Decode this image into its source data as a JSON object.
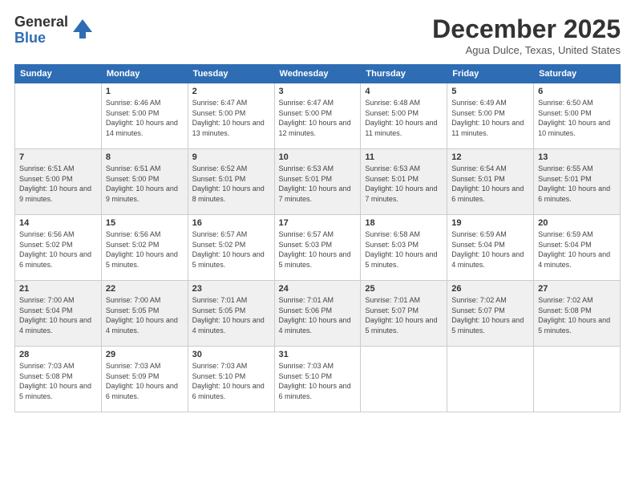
{
  "header": {
    "logo": {
      "general": "General",
      "blue": "Blue"
    },
    "title": "December 2025",
    "subtitle": "Agua Dulce, Texas, United States"
  },
  "weekdays": [
    "Sunday",
    "Monday",
    "Tuesday",
    "Wednesday",
    "Thursday",
    "Friday",
    "Saturday"
  ],
  "weeks": [
    [
      {
        "day": "",
        "sunrise": "",
        "sunset": "",
        "daylight": ""
      },
      {
        "day": "1",
        "sunrise": "Sunrise: 6:46 AM",
        "sunset": "Sunset: 5:00 PM",
        "daylight": "Daylight: 10 hours and 14 minutes."
      },
      {
        "day": "2",
        "sunrise": "Sunrise: 6:47 AM",
        "sunset": "Sunset: 5:00 PM",
        "daylight": "Daylight: 10 hours and 13 minutes."
      },
      {
        "day": "3",
        "sunrise": "Sunrise: 6:47 AM",
        "sunset": "Sunset: 5:00 PM",
        "daylight": "Daylight: 10 hours and 12 minutes."
      },
      {
        "day": "4",
        "sunrise": "Sunrise: 6:48 AM",
        "sunset": "Sunset: 5:00 PM",
        "daylight": "Daylight: 10 hours and 11 minutes."
      },
      {
        "day": "5",
        "sunrise": "Sunrise: 6:49 AM",
        "sunset": "Sunset: 5:00 PM",
        "daylight": "Daylight: 10 hours and 11 minutes."
      },
      {
        "day": "6",
        "sunrise": "Sunrise: 6:50 AM",
        "sunset": "Sunset: 5:00 PM",
        "daylight": "Daylight: 10 hours and 10 minutes."
      }
    ],
    [
      {
        "day": "7",
        "sunrise": "Sunrise: 6:51 AM",
        "sunset": "Sunset: 5:00 PM",
        "daylight": "Daylight: 10 hours and 9 minutes."
      },
      {
        "day": "8",
        "sunrise": "Sunrise: 6:51 AM",
        "sunset": "Sunset: 5:00 PM",
        "daylight": "Daylight: 10 hours and 9 minutes."
      },
      {
        "day": "9",
        "sunrise": "Sunrise: 6:52 AM",
        "sunset": "Sunset: 5:01 PM",
        "daylight": "Daylight: 10 hours and 8 minutes."
      },
      {
        "day": "10",
        "sunrise": "Sunrise: 6:53 AM",
        "sunset": "Sunset: 5:01 PM",
        "daylight": "Daylight: 10 hours and 7 minutes."
      },
      {
        "day": "11",
        "sunrise": "Sunrise: 6:53 AM",
        "sunset": "Sunset: 5:01 PM",
        "daylight": "Daylight: 10 hours and 7 minutes."
      },
      {
        "day": "12",
        "sunrise": "Sunrise: 6:54 AM",
        "sunset": "Sunset: 5:01 PM",
        "daylight": "Daylight: 10 hours and 6 minutes."
      },
      {
        "day": "13",
        "sunrise": "Sunrise: 6:55 AM",
        "sunset": "Sunset: 5:01 PM",
        "daylight": "Daylight: 10 hours and 6 minutes."
      }
    ],
    [
      {
        "day": "14",
        "sunrise": "Sunrise: 6:56 AM",
        "sunset": "Sunset: 5:02 PM",
        "daylight": "Daylight: 10 hours and 6 minutes."
      },
      {
        "day": "15",
        "sunrise": "Sunrise: 6:56 AM",
        "sunset": "Sunset: 5:02 PM",
        "daylight": "Daylight: 10 hours and 5 minutes."
      },
      {
        "day": "16",
        "sunrise": "Sunrise: 6:57 AM",
        "sunset": "Sunset: 5:02 PM",
        "daylight": "Daylight: 10 hours and 5 minutes."
      },
      {
        "day": "17",
        "sunrise": "Sunrise: 6:57 AM",
        "sunset": "Sunset: 5:03 PM",
        "daylight": "Daylight: 10 hours and 5 minutes."
      },
      {
        "day": "18",
        "sunrise": "Sunrise: 6:58 AM",
        "sunset": "Sunset: 5:03 PM",
        "daylight": "Daylight: 10 hours and 5 minutes."
      },
      {
        "day": "19",
        "sunrise": "Sunrise: 6:59 AM",
        "sunset": "Sunset: 5:04 PM",
        "daylight": "Daylight: 10 hours and 4 minutes."
      },
      {
        "day": "20",
        "sunrise": "Sunrise: 6:59 AM",
        "sunset": "Sunset: 5:04 PM",
        "daylight": "Daylight: 10 hours and 4 minutes."
      }
    ],
    [
      {
        "day": "21",
        "sunrise": "Sunrise: 7:00 AM",
        "sunset": "Sunset: 5:04 PM",
        "daylight": "Daylight: 10 hours and 4 minutes."
      },
      {
        "day": "22",
        "sunrise": "Sunrise: 7:00 AM",
        "sunset": "Sunset: 5:05 PM",
        "daylight": "Daylight: 10 hours and 4 minutes."
      },
      {
        "day": "23",
        "sunrise": "Sunrise: 7:01 AM",
        "sunset": "Sunset: 5:05 PM",
        "daylight": "Daylight: 10 hours and 4 minutes."
      },
      {
        "day": "24",
        "sunrise": "Sunrise: 7:01 AM",
        "sunset": "Sunset: 5:06 PM",
        "daylight": "Daylight: 10 hours and 4 minutes."
      },
      {
        "day": "25",
        "sunrise": "Sunrise: 7:01 AM",
        "sunset": "Sunset: 5:07 PM",
        "daylight": "Daylight: 10 hours and 5 minutes."
      },
      {
        "day": "26",
        "sunrise": "Sunrise: 7:02 AM",
        "sunset": "Sunset: 5:07 PM",
        "daylight": "Daylight: 10 hours and 5 minutes."
      },
      {
        "day": "27",
        "sunrise": "Sunrise: 7:02 AM",
        "sunset": "Sunset: 5:08 PM",
        "daylight": "Daylight: 10 hours and 5 minutes."
      }
    ],
    [
      {
        "day": "28",
        "sunrise": "Sunrise: 7:03 AM",
        "sunset": "Sunset: 5:08 PM",
        "daylight": "Daylight: 10 hours and 5 minutes."
      },
      {
        "day": "29",
        "sunrise": "Sunrise: 7:03 AM",
        "sunset": "Sunset: 5:09 PM",
        "daylight": "Daylight: 10 hours and 6 minutes."
      },
      {
        "day": "30",
        "sunrise": "Sunrise: 7:03 AM",
        "sunset": "Sunset: 5:10 PM",
        "daylight": "Daylight: 10 hours and 6 minutes."
      },
      {
        "day": "31",
        "sunrise": "Sunrise: 7:03 AM",
        "sunset": "Sunset: 5:10 PM",
        "daylight": "Daylight: 10 hours and 6 minutes."
      },
      {
        "day": "",
        "sunrise": "",
        "sunset": "",
        "daylight": ""
      },
      {
        "day": "",
        "sunrise": "",
        "sunset": "",
        "daylight": ""
      },
      {
        "day": "",
        "sunrise": "",
        "sunset": "",
        "daylight": ""
      }
    ]
  ]
}
